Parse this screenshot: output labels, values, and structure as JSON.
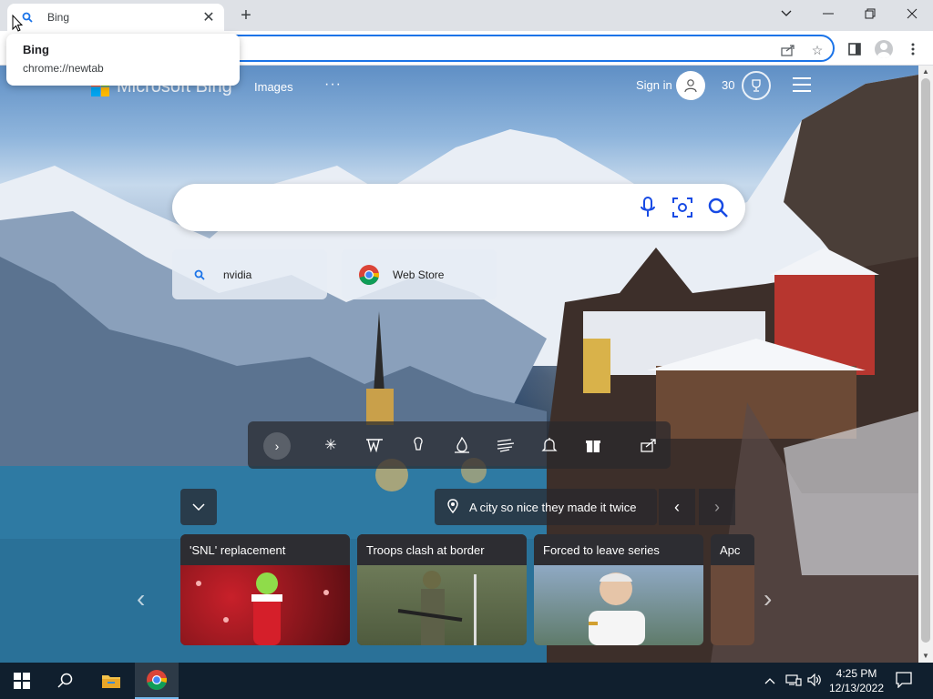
{
  "browser": {
    "tab": {
      "title": "Bing",
      "favicon": "bing-search-icon"
    },
    "tooltip": {
      "title": "Bing",
      "url": "chrome://newtab"
    },
    "window_controls": [
      "chevron-down-icon",
      "minimize-icon",
      "restore-icon",
      "close-icon"
    ],
    "toolbar_icons": [
      "share-icon",
      "star-icon",
      "side-panel-icon",
      "profile-icon",
      "menu-icon"
    ]
  },
  "bing": {
    "logo_text": "Microsoft Bing",
    "nav": {
      "images": "Images",
      "more": "···"
    },
    "signin": "Sign in",
    "points": "30",
    "search": {
      "placeholder": ""
    },
    "quick_links": [
      {
        "label": "nvidia",
        "icon": "search-icon"
      },
      {
        "label": "Web Store",
        "icon": "chrome-logo-icon"
      }
    ],
    "caption": "A city so nice they made it twice",
    "news": [
      {
        "title": "'SNL' replacement"
      },
      {
        "title": "Troops clash at border"
      },
      {
        "title": "Forced to leave series"
      },
      {
        "title": "Apc"
      }
    ],
    "colors": {
      "accent": "#174ae4",
      "omnibox_border": "#1a73e8"
    }
  },
  "taskbar": {
    "time": "4:25 PM",
    "date": "12/13/2022",
    "apps": [
      "windows-start-icon",
      "search-icon",
      "file-explorer-icon",
      "chrome-icon"
    ]
  }
}
